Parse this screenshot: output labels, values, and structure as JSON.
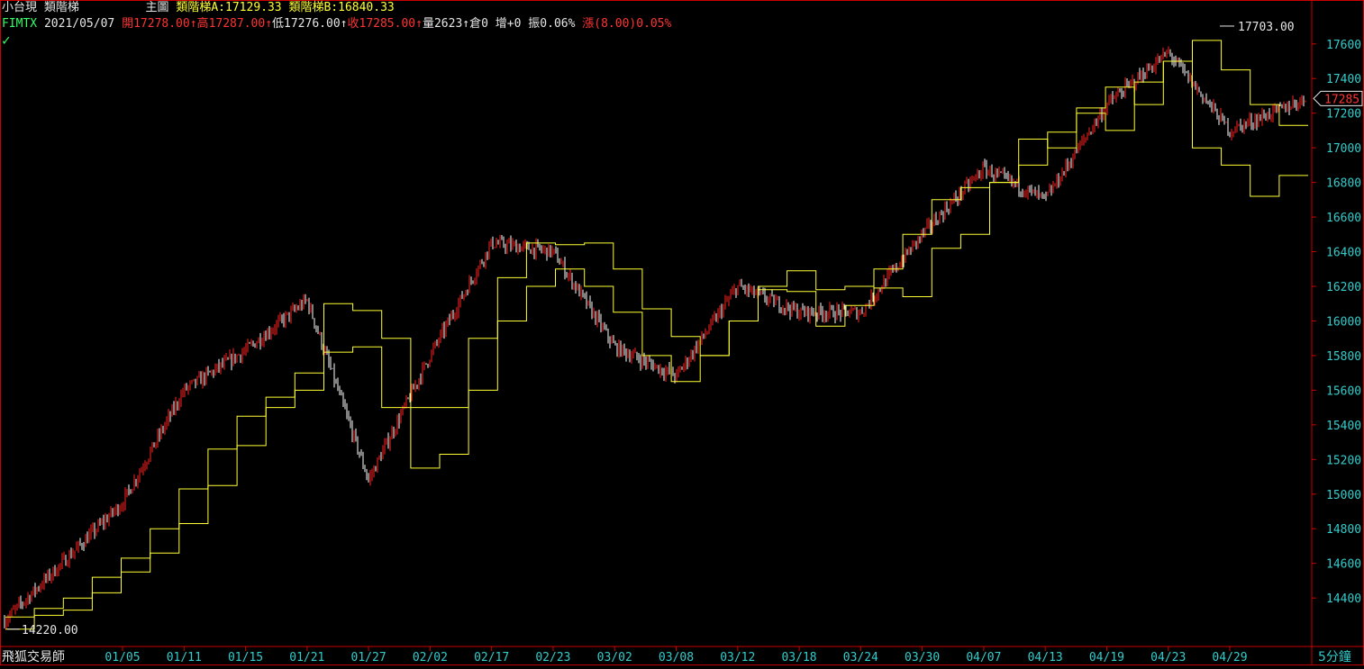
{
  "header": {
    "symbol_name": "小台現",
    "indicator_name": "類階梯",
    "main_label": "主圖",
    "ladder_a_label": "類階梯A:",
    "ladder_a_value": "17129.33",
    "ladder_b_label": "類階梯B:",
    "ladder_b_value": "16840.33",
    "ticker": "FIMTX",
    "date": "2021/05/07",
    "open_label": "開",
    "open_value": "17278.00",
    "high_label": "高",
    "high_value": "17287.00",
    "low_label": "低",
    "low_value": "17276.00",
    "close_label": "收",
    "close_value": "17285.00",
    "volume_label": "量",
    "volume_value": "2623",
    "oi_label": "倉",
    "oi_value": "0",
    "oi_change_label": "增",
    "oi_change_value": "+0",
    "amplitude_label": "振",
    "amplitude_value": "0.06%",
    "change_label": "漲",
    "change_value": "(8.00)0.05%"
  },
  "footer": {
    "app_name": "飛狐交易師",
    "period": "5分鐘"
  },
  "colors": {
    "background": "#000000",
    "frame": "#cc0000",
    "up_candle": "#ff2222",
    "down_candle": "#ffffff",
    "ladder": "#ffff33",
    "axis_text": "#33cccc",
    "check": "#33ff66"
  },
  "chart_data": {
    "type": "candlestick",
    "title": "小台現 類階梯",
    "ylim": [
      14120,
      17760
    ],
    "y_ticks": [
      14400,
      14600,
      14800,
      15000,
      15200,
      15400,
      15600,
      15800,
      16000,
      16200,
      16400,
      16600,
      16800,
      17000,
      17200,
      17400,
      17600
    ],
    "x_ticks": [
      "01/05",
      "01/11",
      "01/15",
      "01/21",
      "01/27",
      "02/02",
      "02/17",
      "02/23",
      "03/02",
      "03/08",
      "03/12",
      "03/18",
      "03/24",
      "03/30",
      "04/07",
      "04/13",
      "04/19",
      "04/23",
      "04/29"
    ],
    "max_label": "17703.00",
    "min_label": "14220.00",
    "last_price_label": "17285",
    "price_path": [
      {
        "x": "start",
        "y": 14270
      },
      {
        "x": "01/05",
        "y": 14950
      },
      {
        "x": "01/11",
        "y": 15600
      },
      {
        "x": "01/15",
        "y": 15830
      },
      {
        "x": "01/21",
        "y": 16120
      },
      {
        "x": "01/27",
        "y": 15080
      },
      {
        "x": "02/02",
        "y": 15800
      },
      {
        "x": "02/17",
        "y": 16450
      },
      {
        "x": "02/23",
        "y": 16400
      },
      {
        "x": "03/02",
        "y": 15850
      },
      {
        "x": "03/08",
        "y": 15680
      },
      {
        "x": "03/12",
        "y": 16200
      },
      {
        "x": "03/18",
        "y": 16050
      },
      {
        "x": "03/24",
        "y": 16050
      },
      {
        "x": "03/30",
        "y": 16500
      },
      {
        "x": "04/07",
        "y": 16880
      },
      {
        "x": "04/13",
        "y": 16700
      },
      {
        "x": "04/19",
        "y": 17250
      },
      {
        "x": "04/23",
        "y": 17550
      },
      {
        "x": "04/29",
        "y": 17100
      },
      {
        "x": "end",
        "y": 17285
      }
    ],
    "series": [
      {
        "name": "類階梯A",
        "last": 17129.33,
        "steps": [
          14290,
          14340,
          14400,
          14520,
          14630,
          14800,
          15030,
          15260,
          15450,
          15560,
          15700,
          16100,
          16060,
          15900,
          15500,
          15500,
          15900,
          16250,
          16450,
          16440,
          16450,
          16300,
          16070,
          15910,
          15800,
          16000,
          16200,
          16290,
          16180,
          16200,
          16190,
          16140,
          16420,
          16500,
          16800,
          17050,
          17000,
          17230,
          17350,
          17250,
          17500,
          17620,
          17450,
          17250,
          17129
        ]
      },
      {
        "name": "類階梯B",
        "last": 16840.33,
        "steps": [
          14220,
          14300,
          14330,
          14430,
          14550,
          14660,
          14830,
          15050,
          15280,
          15500,
          15600,
          15820,
          15850,
          15500,
          15150,
          15230,
          15600,
          16000,
          16200,
          16300,
          16200,
          16050,
          15800,
          15650,
          15800,
          16000,
          16180,
          16170,
          15970,
          16090,
          16300,
          16500,
          16700,
          16770,
          16800,
          16900,
          17090,
          17200,
          17100,
          17380,
          17500,
          17000,
          16900,
          16720,
          16840
        ]
      }
    ]
  }
}
